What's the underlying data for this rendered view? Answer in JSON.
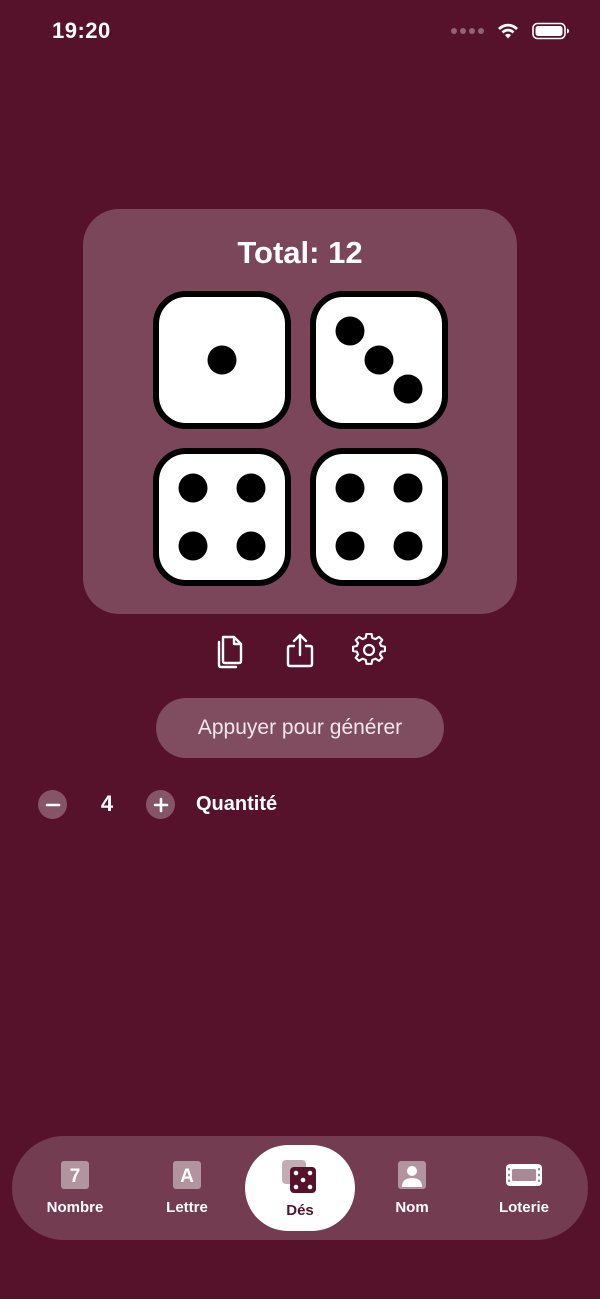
{
  "status_bar": {
    "time": "19:20",
    "icons": [
      "signal-dots-icon",
      "wifi-icon",
      "battery-icon"
    ]
  },
  "dice_card": {
    "total_label": "Total: 12",
    "dice_values": [
      1,
      3,
      4,
      4
    ]
  },
  "actions": {
    "icons": [
      "copy-icon",
      "share-icon",
      "gear-icon"
    ]
  },
  "generate_button": {
    "label": "Appuyer pour générer"
  },
  "quantity": {
    "value": "4",
    "label": "Quantité",
    "decrement_symbol": "−",
    "increment_symbol": "+"
  },
  "tab_bar": {
    "active": "Dés",
    "tabs": [
      {
        "label": "Nombre",
        "icon": "number-7-icon",
        "glyph": "7"
      },
      {
        "label": "Lettre",
        "icon": "letter-a-icon",
        "glyph": "A"
      },
      {
        "label": "Dés",
        "icon": "dice-icon"
      },
      {
        "label": "Nom",
        "icon": "person-icon"
      },
      {
        "label": "Loterie",
        "icon": "ticket-icon"
      }
    ]
  },
  "colors": {
    "background": "#56122b",
    "card": "rgba(255,255,255,0.22)",
    "die_face": "#ffffff",
    "pip": "#000000"
  }
}
